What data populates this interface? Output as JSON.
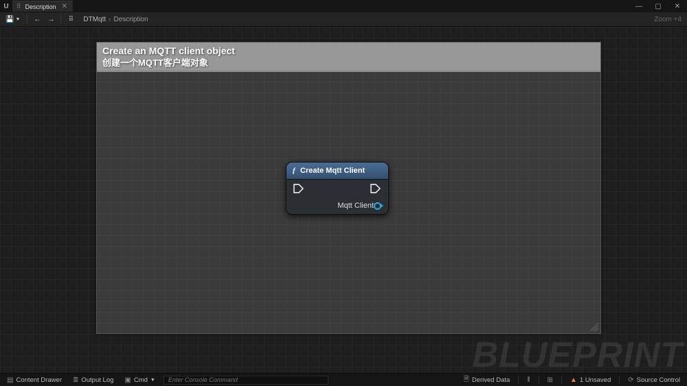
{
  "titlebar": {
    "tab_label": "Description",
    "win_min": "—",
    "win_max": "▢",
    "win_close": "✕"
  },
  "toolbar": {
    "save_glyph": "💾",
    "back_glyph": "←",
    "fwd_glyph": "→",
    "path1": "DTMqtt",
    "path2": "Description",
    "zoom_label": "Zoom +4"
  },
  "comment": {
    "line1": "Create an MQTT client object",
    "line2": "创建一个MQTT客户端对象"
  },
  "node": {
    "title": "Create Mqtt Client",
    "out_pin_label": "Mqtt Client"
  },
  "watermark": "BLUEPRINT",
  "statusbar": {
    "content_drawer": "Content Drawer",
    "output_log": "Output Log",
    "cmd_label": "Cmd",
    "cmd_placeholder": "Enter Console Command",
    "derived_data": "Derived Data",
    "unsaved": "1 Unsaved",
    "source_control": "Source Control"
  }
}
